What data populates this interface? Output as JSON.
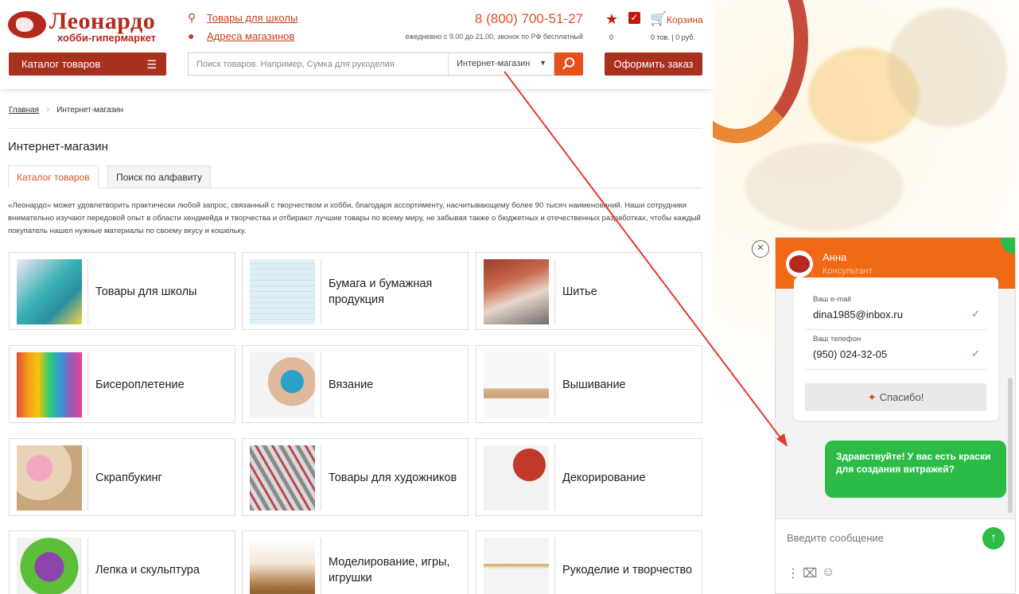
{
  "header": {
    "logo_title": "Леонардо",
    "logo_subtitle": "хобби-гипермаркет",
    "link_school": "Товары для школы",
    "link_stores": "Адреса магазинов",
    "phone": "8 (800) 700-51-27",
    "phone_note": "ежедневно с 9.00 до 21.00, звонок по РФ бесплатный",
    "favorites_count": "0",
    "cart_label": "Корзина",
    "cart_summary": "0 тов. | 0 руб.",
    "catalog_button": "Каталог товаров",
    "search_placeholder": "Поиск товаров. Например, Сумка для рукоделия",
    "search_scope": "Интернет-магазин",
    "order_button": "Оформить заказ"
  },
  "breadcrumb": {
    "home": "Главная",
    "current": "Интернет-магазин"
  },
  "page_title": "Интернет-магазин",
  "tabs": [
    {
      "label": "Каталог товаров"
    },
    {
      "label": "Поиск по алфавиту"
    }
  ],
  "intro": "«Леонардо» может удовлетворить практически любой запрос, связанный с творчеством и хобби, благодаря ассортименту, насчитывающему более 90 тысяч наименований. Наши сотрудники внимательно изучают передовой опыт в области хендмейда и творчества и отбирают лучшие товары по всему миру, не забывая также о бюджетных и отечественных разработках, чтобы каждый покупатель нашел нужные материалы по своему вкусу и кошельку.",
  "categories": [
    {
      "label": "Товары для школы"
    },
    {
      "label": "Бумага и бумажная продукция"
    },
    {
      "label": "Шитье"
    },
    {
      "label": "Бисероплетение"
    },
    {
      "label": "Вязание"
    },
    {
      "label": "Вышивание"
    },
    {
      "label": "Скрапбукинг"
    },
    {
      "label": "Товары для художников"
    },
    {
      "label": "Декорирование"
    },
    {
      "label": "Лепка и скульптура"
    },
    {
      "label": "Моделирование, игры, игрушки"
    },
    {
      "label": "Рукоделие и творчество"
    }
  ],
  "chat": {
    "agent_name": "Анна",
    "agent_role": "Консультант",
    "email_label": "Ваш e-mail",
    "email_value": "dina1985@inbox.ru",
    "phone_label": "Ваш телефон",
    "phone_value": "(950) 024-32-05",
    "thanks_label": "Спасибо!",
    "message": "Здравствуйте! У вас есть краски для создания витражей?",
    "input_placeholder": "Введите сообщение"
  },
  "colors": {
    "brand": "#b5281f",
    "accent": "#e8501b",
    "chat_header": "#f06a16",
    "chat_green": "#2dbb48"
  }
}
